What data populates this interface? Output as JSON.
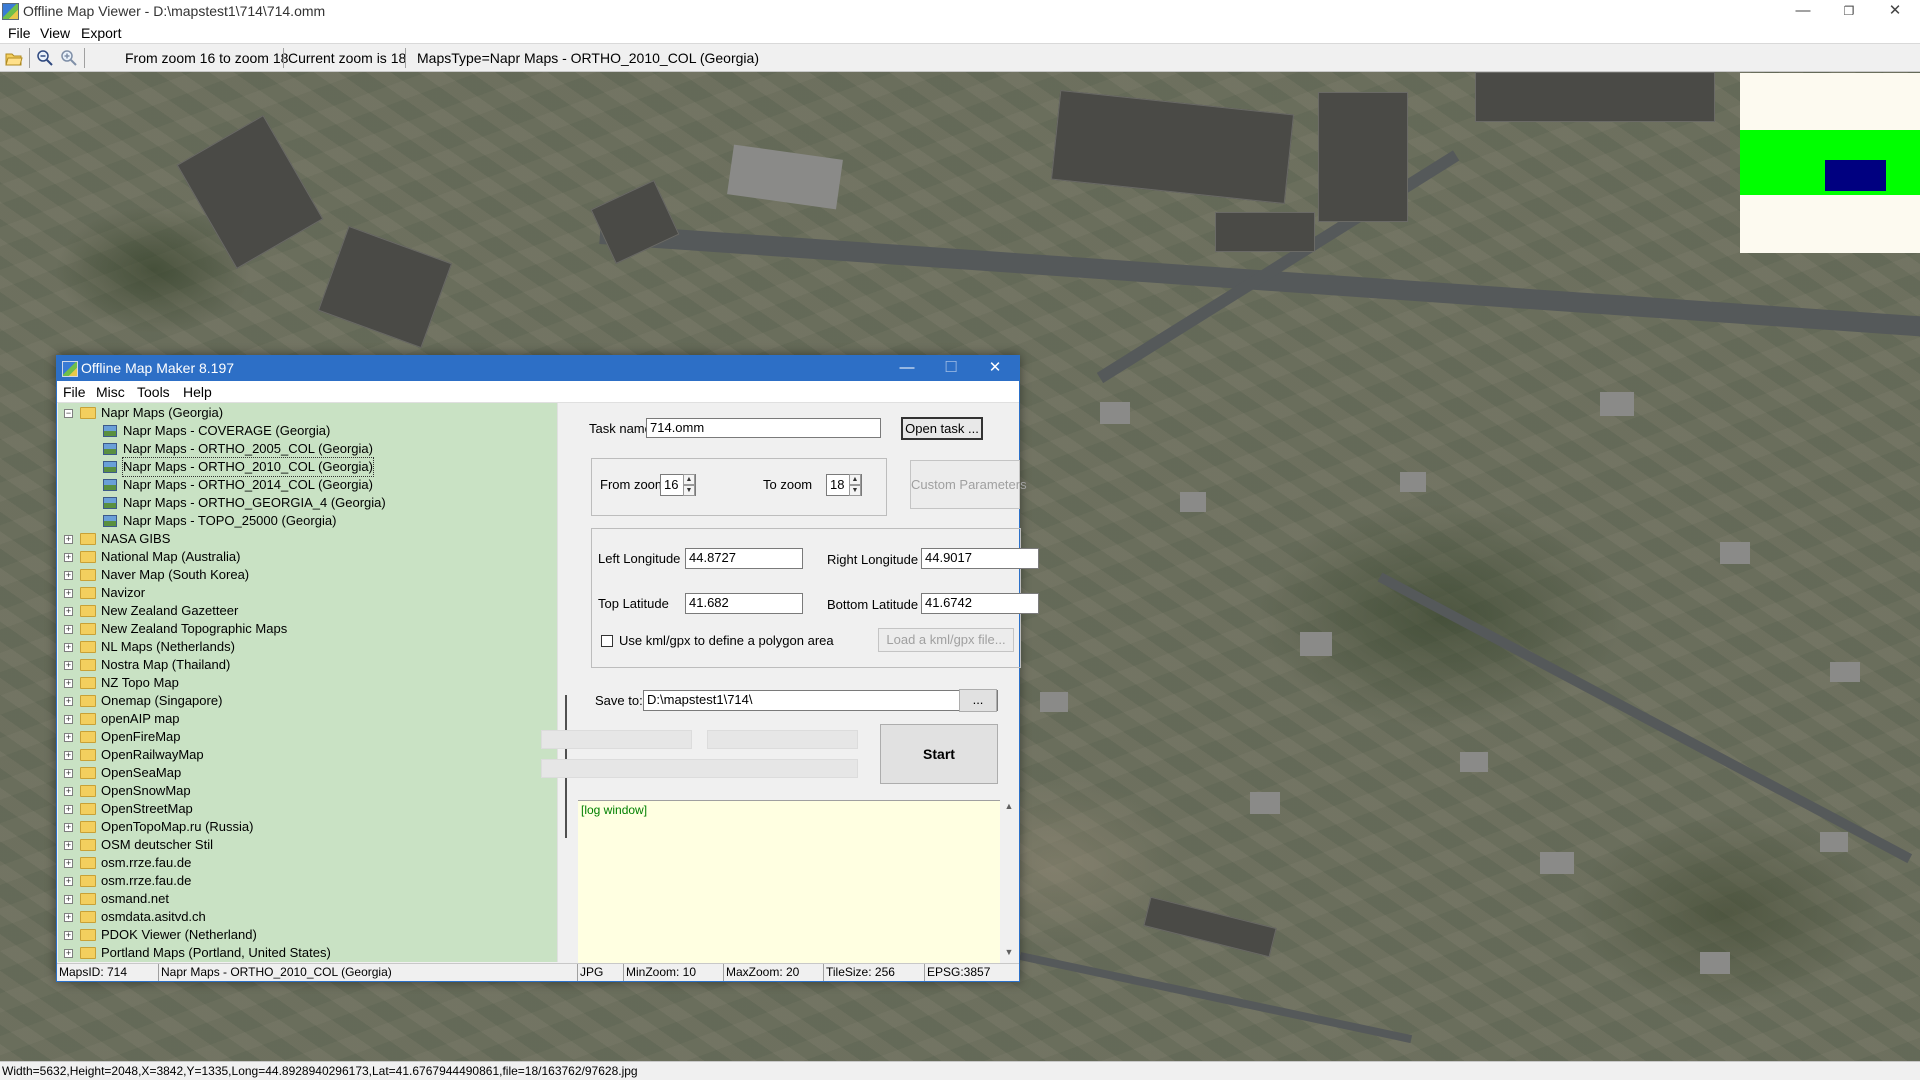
{
  "viewer": {
    "title": "Offline Map Viewer - D:\\mapstest1\\714\\714.omm",
    "controls": {
      "minimize": "—",
      "restore": "❐",
      "close": "✕"
    },
    "menu": [
      "File",
      "View",
      "Export"
    ],
    "toolbar": {
      "zoom_range": "From zoom 16 to zoom 18",
      "current_zoom": "Current zoom is 18",
      "maps_type": "MapsType=Napr Maps - ORTHO_2010_COL (Georgia)"
    },
    "status": "Width=5632,Height=2048,X=3842,Y=1335,Long=44.8928940296173,Lat=41.6767944490861,file=18/163762/97628.jpg"
  },
  "dialog": {
    "title": "Offline Map Maker 8.197",
    "controls": {
      "minimize": "—",
      "maximize": "☐",
      "close": "✕"
    },
    "menu": [
      "File",
      "Misc",
      "Tools",
      "Help"
    ],
    "tree": {
      "root": "Napr Maps (Georgia)",
      "children": [
        "Napr Maps - COVERAGE (Georgia)",
        "Napr Maps - ORTHO_2005_COL (Georgia)",
        "Napr Maps - ORTHO_2010_COL (Georgia)",
        "Napr Maps - ORTHO_2014_COL (Georgia)",
        "Napr Maps - ORTHO_GEORGIA_4 (Georgia)",
        "Napr Maps - TOPO_25000 (Georgia)"
      ],
      "selected_index": 2,
      "folders": [
        "NASA GIBS",
        "National Map (Australia)",
        "Naver Map (South Korea)",
        "Navizor",
        "New Zealand Gazetteer",
        "New Zealand Topographic Maps",
        "NL Maps (Netherlands)",
        "Nostra Map (Thailand)",
        "NZ Topo Map",
        "Onemap (Singapore)",
        "openAIP map",
        "OpenFireMap",
        "OpenRailwayMap",
        "OpenSeaMap",
        "OpenSnowMap",
        "OpenStreetMap",
        "OpenTopoMap.ru (Russia)",
        "OSM deutscher Stil",
        "osm.rrze.fau.de",
        "osm.rrze.fau.de",
        "osmand.net",
        "osmdata.asitvd.ch",
        "PDOK Viewer (Netherland)",
        "Portland Maps (Portland, United States)"
      ]
    },
    "form": {
      "task_name_label": "Task name",
      "task_name_value": "714.omm",
      "open_task_button": "Open task ...",
      "from_zoom_label": "From zoom",
      "from_zoom_value": "16",
      "to_zoom_label": "To zoom",
      "to_zoom_value": "18",
      "custom_params_button": "Custom Parameters",
      "left_lon_label": "Left Longitude",
      "left_lon_value": "44.8727",
      "right_lon_label": "Right Longitude",
      "right_lon_value": "44.9017",
      "top_lat_label": "Top Latitude",
      "top_lat_value": "41.682",
      "bottom_lat_label": "Bottom Latitude",
      "bottom_lat_value": "41.6742",
      "kml_checkbox_label": "Use kml/gpx to define a polygon area",
      "load_kml_button": "Load a kml/gpx file...",
      "save_to_label": "Save to:",
      "save_to_value": "D:\\mapstest1\\714\\",
      "browse_button": "...",
      "start_button": "Start"
    },
    "log_text": "[log window]",
    "status": {
      "maps_id": "MapsID: 714",
      "map_name": "Napr Maps - ORTHO_2010_COL (Georgia)",
      "format": "JPG",
      "min_zoom": "MinZoom: 10",
      "max_zoom": "MaxZoom: 20",
      "tile_size": "TileSize: 256",
      "epsg": "EPSG:3857"
    }
  },
  "colors": {
    "dialog_title": "#2d6fc6",
    "tree_bg": "#c9e2c4",
    "log_bg": "#ffffe1",
    "overview_band": "#00ff00",
    "overview_viewport": "#000080"
  }
}
